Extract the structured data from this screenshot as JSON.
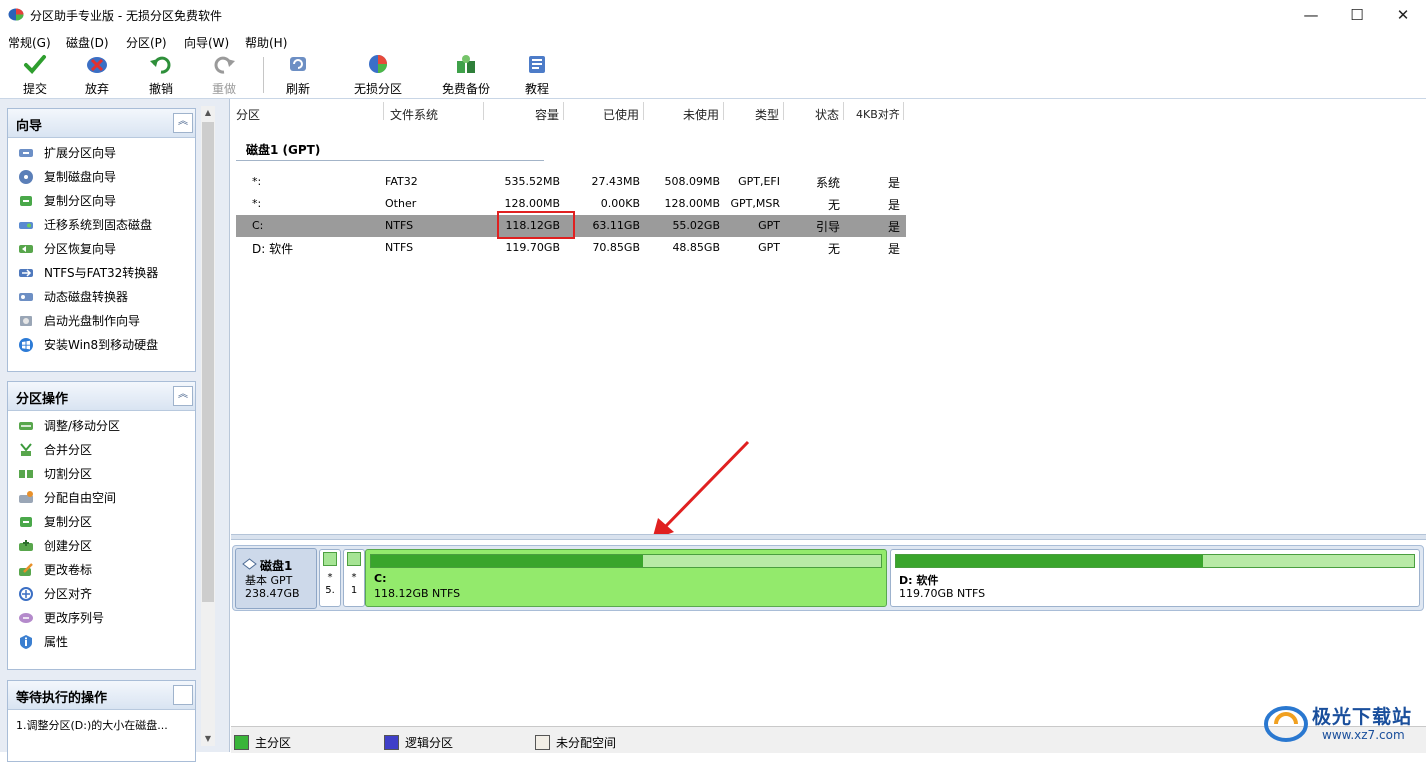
{
  "window": {
    "title": "分区助手专业版 - 无损分区免费软件",
    "controls": [
      "minimize",
      "maximize",
      "close"
    ]
  },
  "menu": [
    "常规(G)",
    "磁盘(D)",
    "分区(P)",
    "向导(W)",
    "帮助(H)"
  ],
  "toolbar": [
    {
      "label": "提交",
      "icon": "commit-checkmark-icon",
      "enabled": true
    },
    {
      "label": "放弃",
      "icon": "discard-icon",
      "enabled": true
    },
    {
      "label": "撤销",
      "icon": "undo-icon",
      "enabled": true
    },
    {
      "label": "重做",
      "icon": "redo-icon",
      "enabled": false
    },
    {
      "label": "刷新",
      "icon": "refresh-icon",
      "enabled": true
    },
    {
      "label": "无损分区",
      "icon": "partition-icon",
      "enabled": true
    },
    {
      "label": "免费备份",
      "icon": "backup-icon",
      "enabled": true
    },
    {
      "label": "教程",
      "icon": "tutorial-icon",
      "enabled": true
    }
  ],
  "wizard": {
    "title": "向导",
    "items": [
      "扩展分区向导",
      "复制磁盘向导",
      "复制分区向导",
      "迁移系统到固态磁盘",
      "分区恢复向导",
      "NTFS与FAT32转换器",
      "动态磁盘转换器",
      "启动光盘制作向导",
      "安装Win8到移动硬盘"
    ]
  },
  "partition_ops": {
    "title": "分区操作",
    "items": [
      "调整/移动分区",
      "合并分区",
      "切割分区",
      "分配自由空间",
      "复制分区",
      "创建分区",
      "更改卷标",
      "分区对齐",
      "更改序列号",
      "属性"
    ]
  },
  "pending": {
    "title": "等待执行的操作",
    "items": [
      "1.调整分区(D:)的大小在磁盘..."
    ]
  },
  "table": {
    "columns": [
      "分区",
      "文件系统",
      "容量",
      "已使用",
      "未使用",
      "类型",
      "状态",
      "4KB对齐"
    ],
    "disk_label": "磁盘1 (GPT)",
    "rows": [
      {
        "partition": "*:",
        "fs": "FAT32",
        "capacity": "535.52MB",
        "used": "27.43MB",
        "free": "508.09MB",
        "type": "GPT,EFI",
        "status": "系统",
        "aligned": "是",
        "selected": false
      },
      {
        "partition": "*:",
        "fs": "Other",
        "capacity": "128.00MB",
        "used": "0.00KB",
        "free": "128.00MB",
        "type": "GPT,MSR",
        "status": "无",
        "aligned": "是",
        "selected": false
      },
      {
        "partition": "C:",
        "fs": "NTFS",
        "capacity": "118.12GB",
        "used": "63.11GB",
        "free": "55.02GB",
        "type": "GPT",
        "status": "引导",
        "aligned": "是",
        "selected": true
      },
      {
        "partition": "D: 软件",
        "fs": "NTFS",
        "capacity": "119.70GB",
        "used": "70.85GB",
        "free": "48.85GB",
        "type": "GPT",
        "status": "无",
        "aligned": "是",
        "selected": false
      }
    ]
  },
  "diskmap": {
    "disk_name": "磁盘1",
    "disk_style": "基本 GPT",
    "disk_size": "238.47GB",
    "tiny_parts": [
      {
        "line1": "*",
        "line2": "5."
      },
      {
        "line1": "*",
        "line2": "1"
      }
    ],
    "parts": [
      {
        "name": "C:",
        "info": "118.12GB NTFS",
        "used_fraction": 0.534,
        "selected": true
      },
      {
        "name": "D: 软件",
        "info": "119.70GB NTFS",
        "used_fraction": 0.592,
        "selected": false
      }
    ]
  },
  "legend": [
    {
      "label": "主分区",
      "color": "#3ab53a"
    },
    {
      "label": "逻辑分区",
      "color": "#3f3fc8"
    },
    {
      "label": "未分配空间",
      "color": "#f2eee6"
    }
  ],
  "colors": {
    "selected_row": "#9b9b9b",
    "annotation_red": "#e02020",
    "selected_partition": "#93ea6c",
    "used_bar": "#3aa52c"
  },
  "watermark": {
    "line1": "极光下载站",
    "line2": "www.xz7.com"
  }
}
